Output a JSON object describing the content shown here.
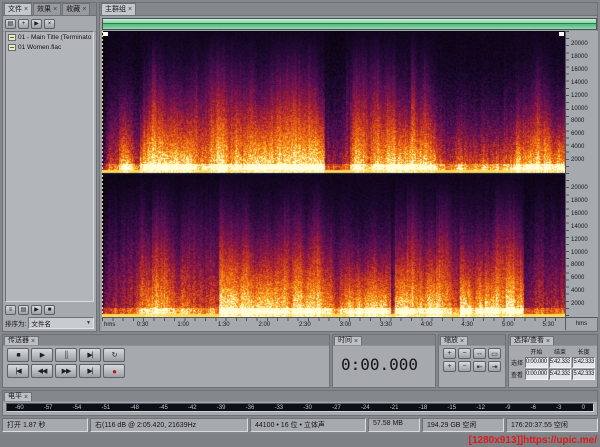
{
  "ui": {
    "close_glyph": "×"
  },
  "files_panel": {
    "tabs": [
      "文件",
      "效果",
      "收藏"
    ],
    "toolbar": {
      "icons": [
        {
          "name": "import-file-icon",
          "glyph": "▤"
        },
        {
          "name": "new-file-icon",
          "glyph": "+"
        },
        {
          "name": "play-preview-icon",
          "glyph": "▶"
        },
        {
          "name": "delete-file-icon",
          "glyph": "×"
        }
      ]
    },
    "items": [
      "01 - Main Title (Terminato",
      "01 Women.flac"
    ],
    "footer_icons": [
      {
        "name": "show-options-icon",
        "glyph": "≡"
      },
      {
        "name": "filter-files-icon",
        "glyph": "▤"
      },
      {
        "name": "auto-play-icon",
        "glyph": "▶"
      },
      {
        "name": "stop-preview-icon",
        "glyph": "■"
      }
    ],
    "sort_label": "排序为:",
    "sort_value": "文件名",
    "sort_arrow": "▼"
  },
  "main_panel": {
    "tab": "主群组"
  },
  "ruler": {
    "time_unit": "hms",
    "corner_label": "hms",
    "time_labels": [
      "0:30",
      "1:00",
      "1:30",
      "2:00",
      "2:30",
      "3:00",
      "3:30",
      "4:00",
      "4:30",
      "5:00",
      "5:30"
    ],
    "freq_labels": [
      "20000",
      "18000",
      "16000",
      "14000",
      "12000",
      "10000",
      "8000",
      "6000",
      "4000",
      "2000"
    ]
  },
  "transport": {
    "title": "传送器",
    "row1": [
      {
        "name": "stop-button",
        "glyph": "■"
      },
      {
        "name": "play-button",
        "glyph": "▶"
      },
      {
        "name": "pause-button",
        "glyph": "║"
      },
      {
        "name": "play-to-end-button",
        "glyph": "▶|"
      },
      {
        "name": "loop-play-button",
        "glyph": "↻"
      }
    ],
    "row2": [
      {
        "name": "go-to-start-button",
        "glyph": "|◀"
      },
      {
        "name": "rewind-button",
        "glyph": "◀◀"
      },
      {
        "name": "fast-forward-button",
        "glyph": "▶▶"
      },
      {
        "name": "go-to-end-button",
        "glyph": "▶|"
      },
      {
        "name": "record-button",
        "glyph": "●"
      }
    ]
  },
  "time_panel": {
    "title": "时间",
    "value": "0:00.000"
  },
  "zoom_panel": {
    "title": "缩放",
    "row1": [
      {
        "name": "zoom-in-horizontal-button",
        "glyph": "+"
      },
      {
        "name": "zoom-out-horizontal-button",
        "glyph": "−"
      },
      {
        "name": "zoom-full-button",
        "glyph": "↔"
      },
      {
        "name": "zoom-to-selection-button",
        "glyph": "▭"
      }
    ],
    "row2": [
      {
        "name": "zoom-in-vertical-button",
        "glyph": "+"
      },
      {
        "name": "zoom-out-vertical-button",
        "glyph": "−"
      },
      {
        "name": "zoom-left-edge-button",
        "glyph": "⇤"
      },
      {
        "name": "zoom-right-edge-button",
        "glyph": "⇥"
      }
    ]
  },
  "selview_panel": {
    "title": "选择/查看",
    "headers": [
      "开始",
      "结束",
      "长度"
    ],
    "rows": [
      {
        "label": "选择",
        "values": [
          "0:00.000",
          "5:42.333",
          "5:42.333"
        ]
      },
      {
        "label": "查看",
        "values": [
          "0:00.000",
          "5:42.333",
          "5:42.333"
        ]
      }
    ]
  },
  "levels_panel": {
    "title": "电平",
    "scale": [
      "-60",
      "-57",
      "-54",
      "-51",
      "-48",
      "-45",
      "-42",
      "-39",
      "-36",
      "-33",
      "-30",
      "-27",
      "-24",
      "-21",
      "-18",
      "-15",
      "-12",
      "-9",
      "-6",
      "-3",
      "0"
    ]
  },
  "status": {
    "open_info": "打开 1.87 秒",
    "cursor_info": "右(116 dB @ 2:05.420, 21639Hz",
    "format_info": "44100 • 16 位 • 立体声",
    "file_size": "57.58 MB",
    "disk_free": "194.29 GB 空闲",
    "time_free": "176:20:37.55 空闲",
    "watermark": "[1280x913]]https://upic.me/"
  }
}
